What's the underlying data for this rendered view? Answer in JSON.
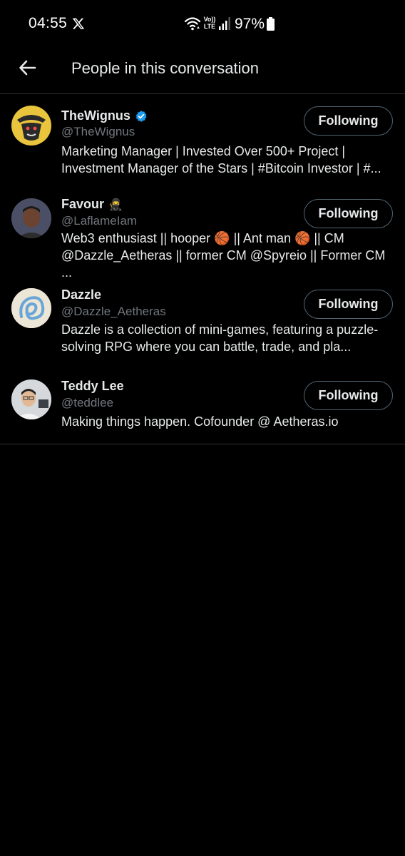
{
  "status_bar": {
    "time": "04:55",
    "battery": "97%",
    "volte_top": "Vo))",
    "volte_bottom": "LTE",
    "icons": [
      "x-logo-icon",
      "wifi-icon",
      "volte-icon",
      "signal-icon",
      "battery-icon"
    ]
  },
  "header": {
    "title": "People in this conversation",
    "back_icon": "arrow-left-icon"
  },
  "people": [
    {
      "name": "TheWignus",
      "verified": true,
      "handle": "@TheWignus",
      "bio": "Marketing Manager | Invested Over 500+ Project | Investment Manager of the Stars | #Bitcoin Investor | #...",
      "button": "Following"
    },
    {
      "name": "Favour",
      "name_emoji": "🥷",
      "handle": "@LaflameIam",
      "bio": "Web3 enthusiast || hooper 🏀 || Ant man 🏀 || CM @Dazzle_Aetheras || former CM @Spyreio || Former CM ...",
      "button": "Following"
    },
    {
      "name": "Dazzle",
      "handle": "@Dazzle_Aetheras",
      "bio": "Dazzle is a collection of mini-games, featuring a puzzle-solving RPG where you can battle, trade, and pla...",
      "button": "Following"
    },
    {
      "name": "Teddy Lee",
      "handle": "@teddlee",
      "bio": "Making things happen. Cofounder @ Aetheras.io",
      "button": "Following"
    }
  ],
  "colors": {
    "background": "#000000",
    "text": "#e7e9ea",
    "secondary_text": "#71767b",
    "verified_badge": "#1d9bf0",
    "border": "#2f3336"
  }
}
